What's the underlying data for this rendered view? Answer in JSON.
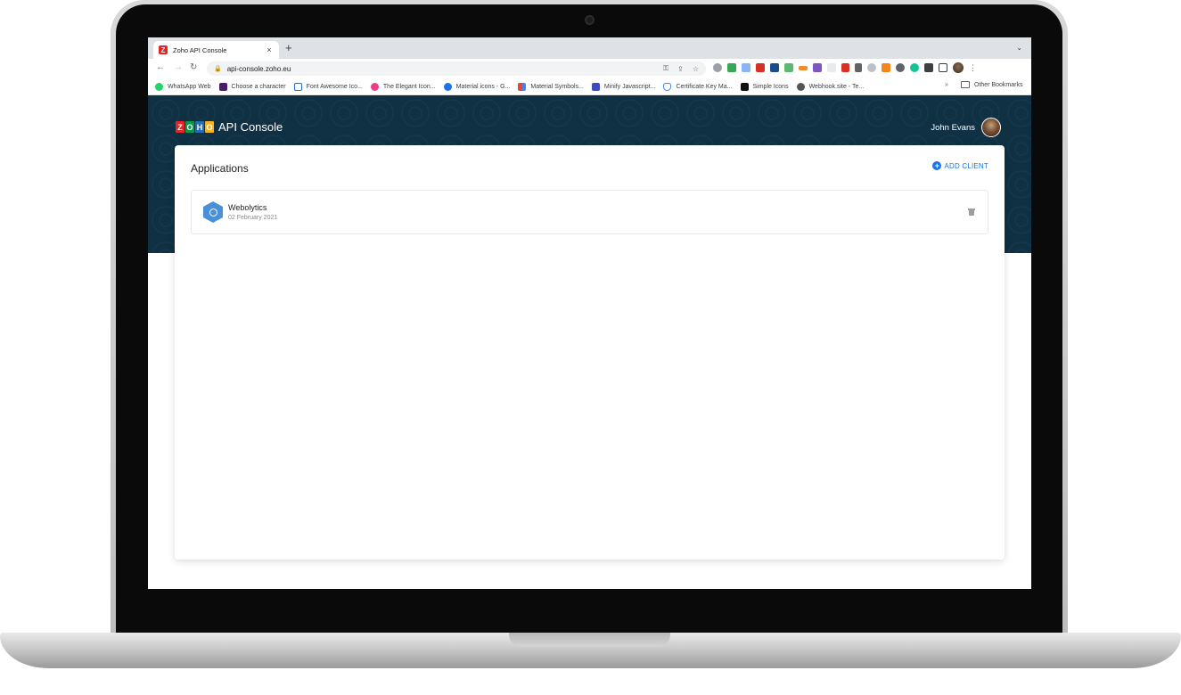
{
  "browser": {
    "tab": {
      "title": "Zoho API Console",
      "favicon_letter": "Z"
    },
    "new_tab_symbol": "+",
    "tab_menu_symbol": "⌄",
    "close_symbol": "×",
    "nav": {
      "back": "←",
      "forward": "→",
      "reload": "↻"
    },
    "url": "api-console.zoho.eu",
    "bookmarks": [
      {
        "label": "WhatsApp Web",
        "color": "#25d366"
      },
      {
        "label": "Choose a character",
        "color": "#4b1a6b"
      },
      {
        "label": "Font Awesome Ico...",
        "color": "#1d6bd6"
      },
      {
        "label": "The Elegant Icon...",
        "color": "#e83e8c"
      },
      {
        "label": "Material icons - G...",
        "color": "#1a73e8"
      },
      {
        "label": "Material Symbols...",
        "color": "#fbbc04"
      },
      {
        "label": "Minify Javascript...",
        "color": "#3b4cc0"
      },
      {
        "label": "Certificate Key Ma...",
        "color": "#4285f4"
      },
      {
        "label": "Simple Icons",
        "color": "#111111"
      },
      {
        "label": "Webhook.site - Te...",
        "color": "#555555"
      }
    ],
    "bookmarks_overflow": "»",
    "other_bookmarks": "Other Bookmarks"
  },
  "header": {
    "logo_letters": [
      "Z",
      "O",
      "H",
      "O"
    ],
    "logo_colors": [
      "#e42527",
      "#089949",
      "#226db4",
      "#f9b21d"
    ],
    "title": "API Console",
    "user_name": "John Evans"
  },
  "main": {
    "title": "Applications",
    "add_client_label": "ADD CLIENT",
    "applications": [
      {
        "name": "Webolytics",
        "date": "02 February 2021"
      }
    ]
  },
  "colors": {
    "header_bg": "#0f3143",
    "accent": "#1a73e8"
  }
}
